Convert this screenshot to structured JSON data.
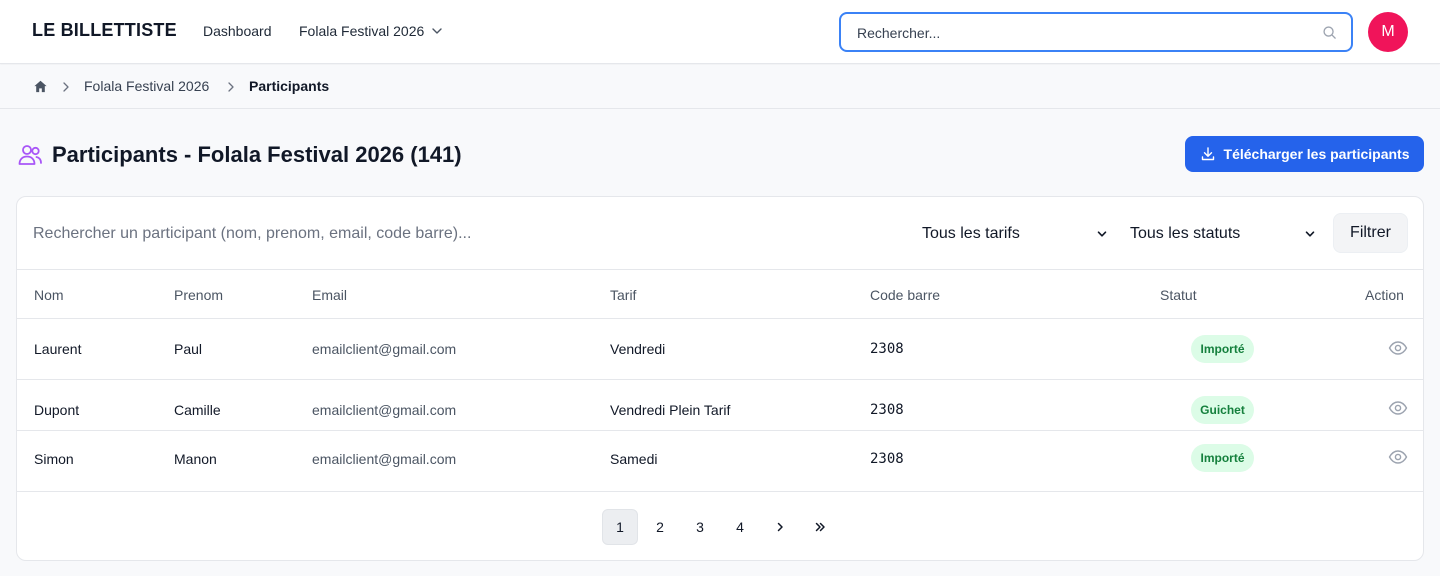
{
  "navbar": {
    "brand": "LE BILLETTISTE",
    "dashboard_label": "Dashboard",
    "event_label": "Folala Festival 2026",
    "search_placeholder": "Rechercher...",
    "avatar_initial": "M",
    "avatar_color": "#f0145a"
  },
  "breadcrumb": {
    "event": "Folala Festival 2026",
    "current": "Participants"
  },
  "page": {
    "title": "Participants - Folala Festival 2026 (141)",
    "download_label": "Télécharger les participants",
    "accent_color": "#2563eb",
    "icon_color": "#a855f7"
  },
  "filters": {
    "search_placeholder": "Rechercher un participant (nom, prenom, email, code barre)...",
    "tarif_selected": "Tous les tarifs",
    "statut_selected": "Tous les statuts",
    "filter_label": "Filtrer"
  },
  "table": {
    "headers": {
      "nom": "Nom",
      "prenom": "Prenom",
      "email": "Email",
      "tarif": "Tarif",
      "code": "Code barre",
      "statut": "Statut",
      "action": "Action"
    },
    "rows": [
      {
        "nom": "Laurent",
        "prenom": "Paul",
        "email": "emailclient@gmail.com",
        "tarif": "Vendredi",
        "code": "2308",
        "statut": "Importé"
      },
      {
        "nom": "Dupont",
        "prenom": "Camille",
        "email": "emailclient@gmail.com",
        "tarif": "Vendredi Plein Tarif",
        "code": "2308",
        "statut": "Guichet"
      },
      {
        "nom": "Simon",
        "prenom": "Manon",
        "email": "emailclient@gmail.com",
        "tarif": "Samedi",
        "code": "2308",
        "statut": "Importé"
      }
    ]
  },
  "pagination": {
    "pages": [
      "1",
      "2",
      "3",
      "4"
    ],
    "current": "1"
  }
}
